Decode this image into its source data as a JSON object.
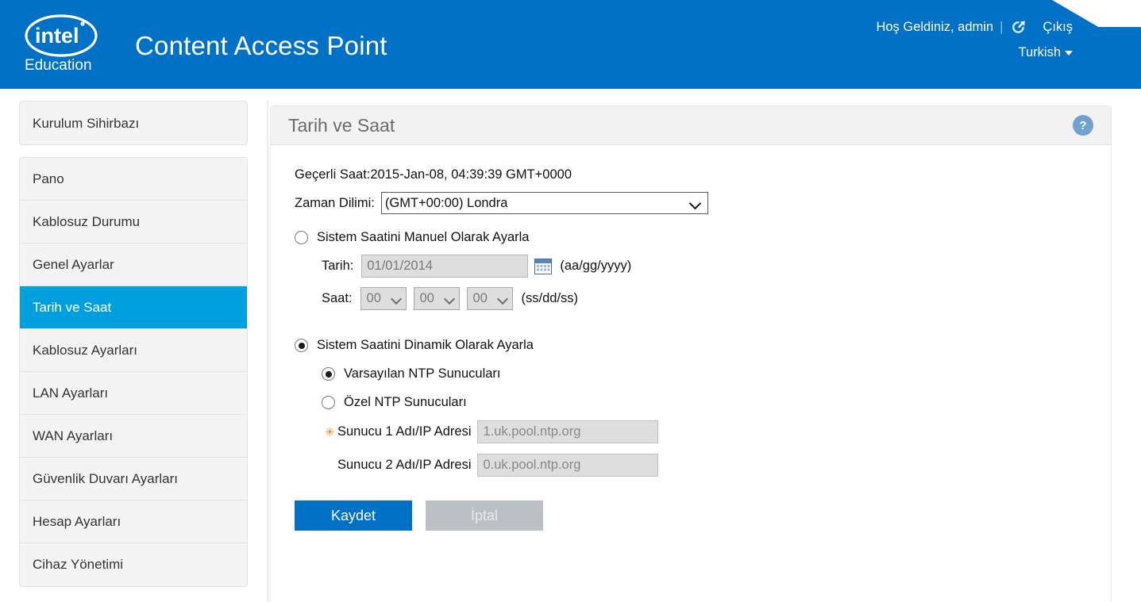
{
  "header": {
    "brand_logo": "intel-education-logo",
    "brand_text": "Education",
    "brand_mark": "intel",
    "app_title": "Content Access Point",
    "welcome": "Hoş Geldiniz, admin",
    "separator": "|",
    "logout_icon": "external-link-circle-icon",
    "logout_label": "Çıkış",
    "language": "Turkish",
    "accent_color": "#0071c5"
  },
  "sidebar": {
    "wizard": {
      "label": "Kurulum Sihirbazı"
    },
    "items": [
      {
        "label": "Pano",
        "active": false
      },
      {
        "label": "Kablosuz Durumu",
        "active": false
      },
      {
        "label": "Genel Ayarlar",
        "active": false
      },
      {
        "label": "Tarih ve Saat",
        "active": true
      },
      {
        "label": "Kablosuz Ayarları",
        "active": false
      },
      {
        "label": "LAN Ayarları",
        "active": false
      },
      {
        "label": "WAN Ayarları",
        "active": false
      },
      {
        "label": "Güvenlik Duvarı Ayarları",
        "active": false
      },
      {
        "label": "Hesap Ayarları",
        "active": false
      },
      {
        "label": "Cihaz Yönetimi",
        "active": false
      }
    ],
    "active_color": "#00a0df"
  },
  "panel": {
    "title": "Tarih ve Saat",
    "help_icon": "question-mark-icon",
    "help_glyph": "?"
  },
  "form": {
    "current_time": "Geçerli Saat:2015-Jan-08, 04:39:39 GMT+0000",
    "timezone_label": "Zaman Dilimi:",
    "timezone_value": "(GMT+00:00) Londra",
    "manual": {
      "radio_label": "Sistem Saatini Manuel Olarak Ayarla",
      "selected": false,
      "date_label": "Tarih:",
      "date_value": "01/01/2014",
      "calendar_icon": "calendar-icon",
      "date_hint": "(aa/gg/yyyy)",
      "time_label": "Saat:",
      "hour": "00",
      "minute": "00",
      "second": "00",
      "time_hint": "(ss/dd/ss)"
    },
    "dynamic": {
      "radio_label": "Sistem Saatini Dinamik Olarak Ayarla",
      "selected": true,
      "default_ntp_label": "Varsayılan NTP Sunucuları",
      "default_ntp_selected": true,
      "custom_ntp_label": "Özel NTP Sunucuları",
      "custom_ntp_selected": false,
      "required_mark": "✳",
      "server1_label": "Sunucu 1 Adı/IP Adresi",
      "server1_value": "1.uk.pool.ntp.org",
      "server2_label": "Sunucu 2 Adı/IP Adresi",
      "server2_value": "0.uk.pool.ntp.org",
      "required_color": "#f08a24"
    },
    "buttons": {
      "save": "Kaydet",
      "cancel": "İptal",
      "save_color": "#0071c5",
      "cancel_color": "#bcc0c4"
    }
  }
}
